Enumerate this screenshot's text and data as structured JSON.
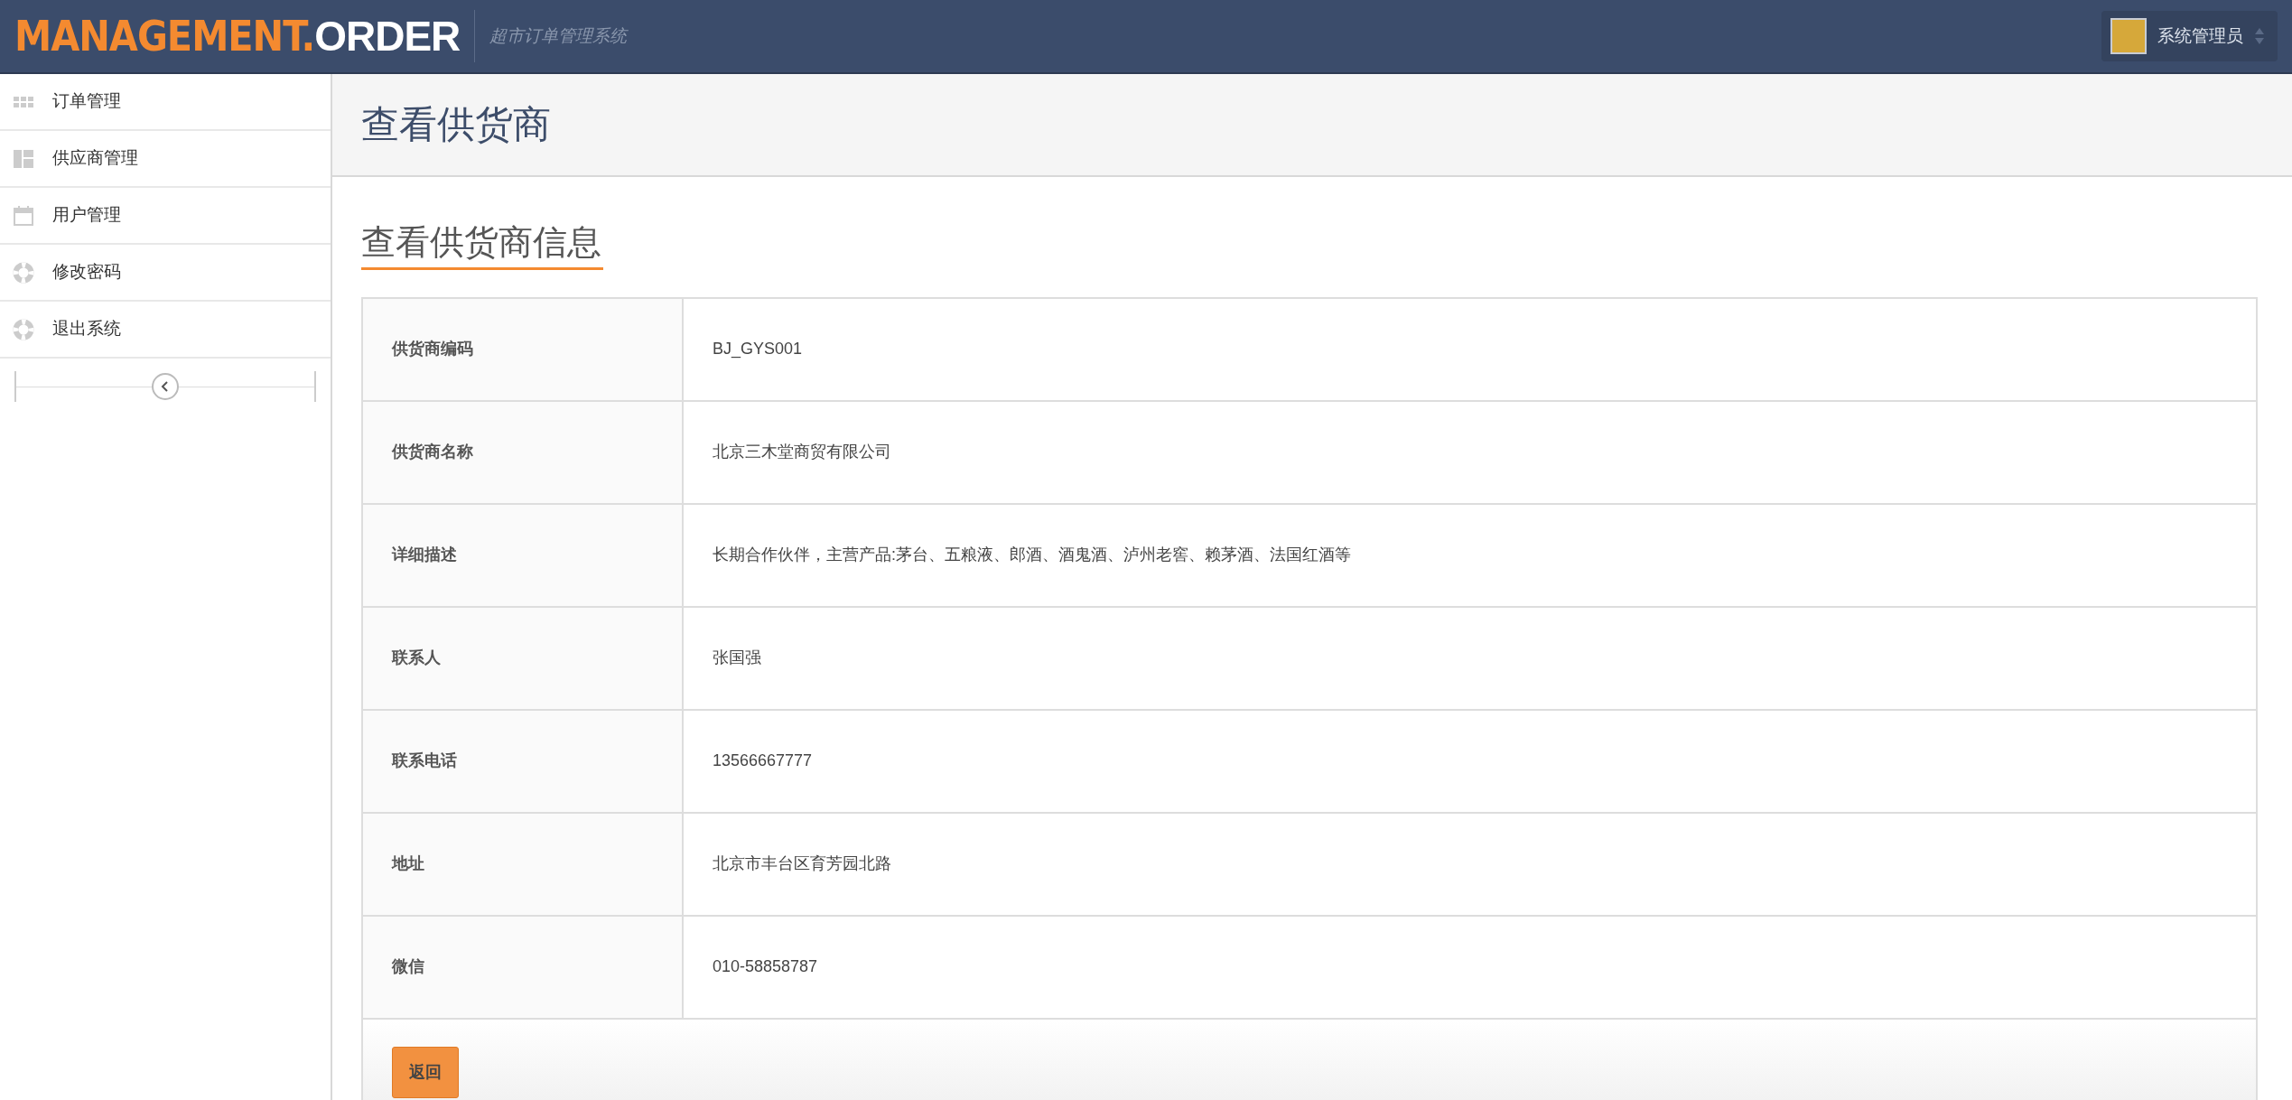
{
  "header": {
    "logo_primary": "MANAGEMENT.",
    "logo_secondary": "ORDER",
    "subtitle": "超市订单管理系统",
    "user": {
      "name": "系统管理员"
    }
  },
  "sidebar": {
    "items": [
      {
        "label": "订单管理",
        "kind": "grid"
      },
      {
        "label": "供应商管理",
        "kind": "layout"
      },
      {
        "label": "用户管理",
        "kind": "calendar"
      },
      {
        "label": "修改密码",
        "kind": "lifebuoy"
      },
      {
        "label": "退出系统",
        "kind": "lifebuoy"
      }
    ]
  },
  "page_title": "查看供货商",
  "section_title": "查看供货商信息",
  "details": [
    {
      "label": "供货商编码",
      "value": "BJ_GYS001"
    },
    {
      "label": "供货商名称",
      "value": "北京三木堂商贸有限公司"
    },
    {
      "label": "详细描述",
      "value": "长期合作伙伴，主营产品:茅台、五粮液、郎酒、酒鬼酒、泸州老窖、赖茅酒、法国红酒等"
    },
    {
      "label": "联系人",
      "value": "张国强"
    },
    {
      "label": "联系电话",
      "value": "13566667777"
    },
    {
      "label": "地址",
      "value": "北京市丰台区育芳园北路"
    },
    {
      "label": "微信",
      "value": "010-58858787"
    }
  ],
  "buttons": [
    {
      "label": "返回"
    }
  ]
}
